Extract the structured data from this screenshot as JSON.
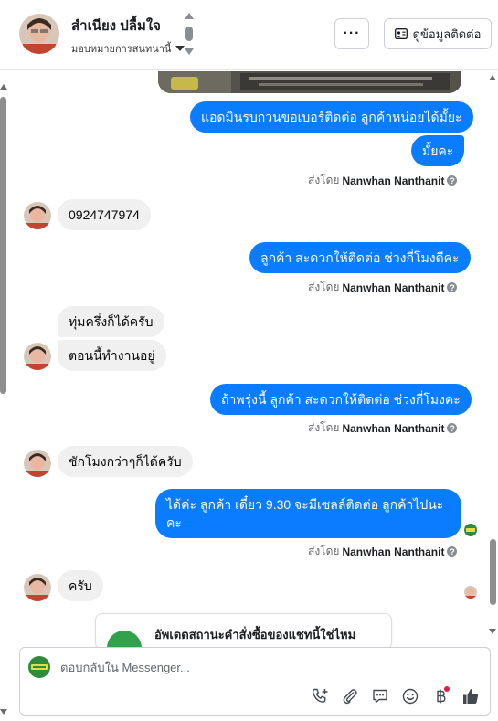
{
  "header": {
    "contact_name": "สำเนียง ปลื้มใจ",
    "assign_label": "มอบหมายการสนทนานี้",
    "more_label": "···",
    "view_contact_label": "ดูข้อมูลติดต่อ"
  },
  "messages": [
    {
      "dir": "out",
      "text": "แอดมินรบกวนขอเบอร์ติดต่อ ลูกค้าหน่อยได้มั้ยะ"
    },
    {
      "dir": "out",
      "text": "มั้ยคะ"
    },
    {
      "dir": "in",
      "text": "0924747974"
    },
    {
      "dir": "out",
      "text": "ลูกค้า สะดวกให้ติดต่อ ช่วงกี่โมงดีคะ"
    },
    {
      "dir": "in",
      "text": "ทุ่มครึ่งก็ได้ครับ"
    },
    {
      "dir": "in",
      "text": "ตอนนี้ทำงานอยู่"
    },
    {
      "dir": "out",
      "text": "ถ้าพรุ่งนี้ ลูกค้า สะดวกให้ติดต่อ ช่วงกี่โมงคะ"
    },
    {
      "dir": "in",
      "text": "ชักโมงกว่าๆก็ได้ครับ"
    },
    {
      "dir": "out",
      "text": "ได้ค่ะ  ลูกค้า  เดี๋ยว 9.30 จะมีเซลล์ติดต่อ ลูกค้าไปนะ",
      "line2": "คะ"
    },
    {
      "dir": "in",
      "text": "ครับ"
    }
  ],
  "sent_by": {
    "prefix": "ส่งโดย",
    "name": "Nanwhan Nanthanit",
    "help_icon": "?"
  },
  "card": {
    "text": "อัพเดตสถานะคำสั่งซื้อของแชทนี้ใช่ไหม"
  },
  "composer": {
    "placeholder": "ตอบกลับใน Messenger...",
    "icons": [
      "phone-plus-icon",
      "paperclip-icon",
      "chat-bubble-icon",
      "emoji-icon",
      "baht-icon",
      "thumbs-up-icon"
    ]
  },
  "colors": {
    "accent": "#0a7cff",
    "incoming": "#f0f0f0"
  }
}
